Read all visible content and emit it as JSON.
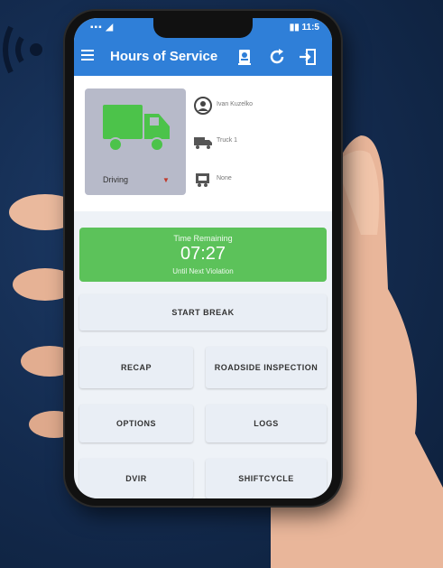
{
  "statusbar": {
    "left": "▪▪▪ ◢",
    "right": "▮▮ 11:5"
  },
  "appbar": {
    "title": "Hours of Service",
    "icons": [
      "menu-icon",
      "id-badge-icon",
      "refresh-icon",
      "logout-icon"
    ]
  },
  "status_card": {
    "duty_status": "Driving",
    "driver_name": "Ivan Kuzelko",
    "truck": "Truck 1",
    "trailer": "None",
    "colors": {
      "truck": "#4cc34a",
      "panel": "#b7bac9"
    }
  },
  "time_remaining": {
    "label": "Time Remaining",
    "value": "07:27",
    "sub": "Until Next Violation",
    "color": "#5cc25a"
  },
  "buttons": {
    "start_break": "START BREAK",
    "recap": "RECAP",
    "roadside_inspection": "ROADSIDE INSPECTION",
    "options": "OPTIONS",
    "logs": "LOGS",
    "dvir": "DVIR",
    "shiftcycle": "SHIFTCYCLE"
  },
  "colors": {
    "accent": "#2f7fd8",
    "background": "#132a4d"
  }
}
